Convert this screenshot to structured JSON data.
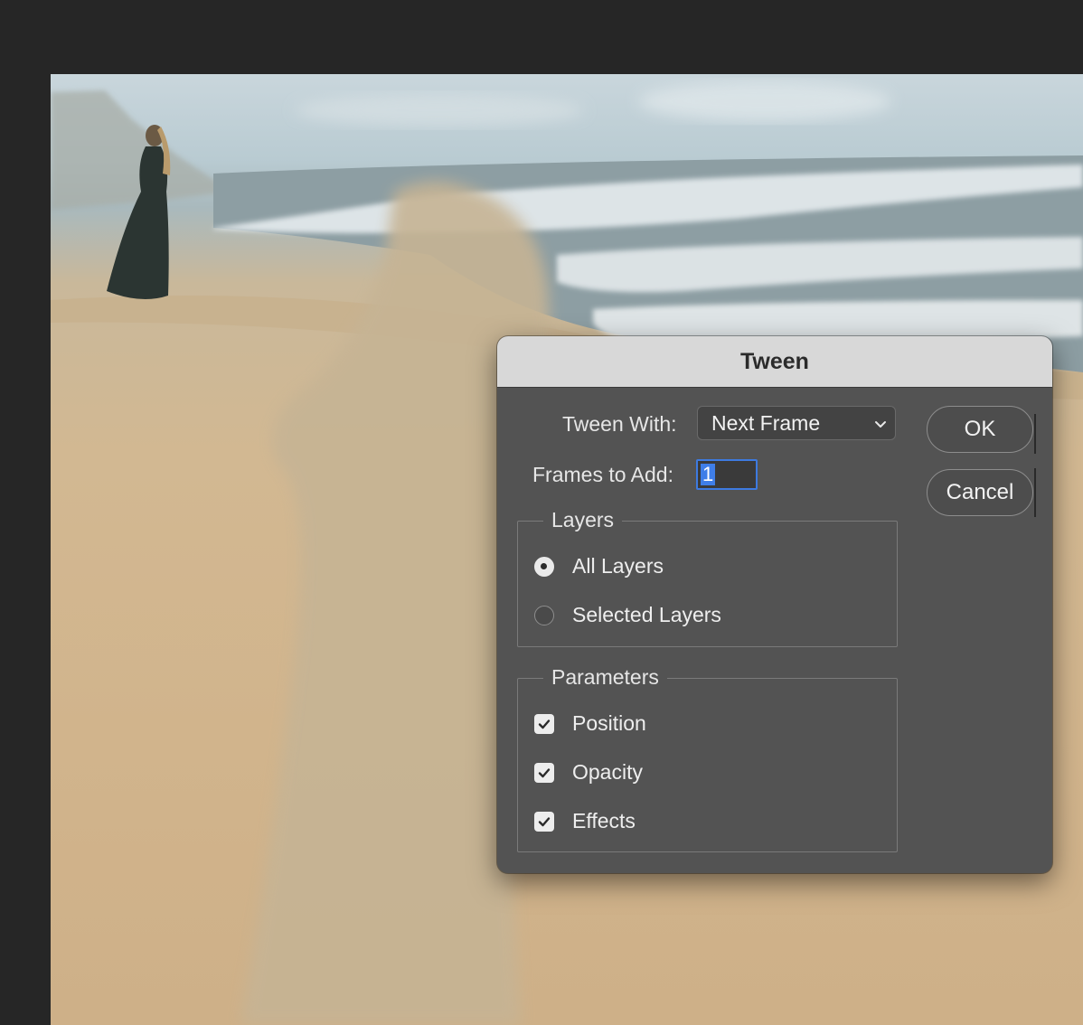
{
  "dialog": {
    "title": "Tween",
    "tween_with_label": "Tween With:",
    "tween_with_value": "Next Frame",
    "frames_label": "Frames to Add:",
    "frames_value": "1",
    "ok_label": "OK",
    "cancel_label": "Cancel",
    "layers": {
      "legend": "Layers",
      "options": [
        {
          "label": "All Layers",
          "selected": true
        },
        {
          "label": "Selected Layers",
          "selected": false
        }
      ]
    },
    "parameters": {
      "legend": "Parameters",
      "items": [
        {
          "label": "Position",
          "checked": true
        },
        {
          "label": "Opacity",
          "checked": true
        },
        {
          "label": "Effects",
          "checked": true
        }
      ]
    }
  },
  "icons": {
    "dropdown": "chevron-down-icon",
    "check": "checkmark-icon"
  },
  "colors": {
    "dialog_bg": "#535353",
    "titlebar_bg": "#d8d8d8",
    "focus_ring": "#3d7ae0",
    "app_bg": "#262626"
  }
}
